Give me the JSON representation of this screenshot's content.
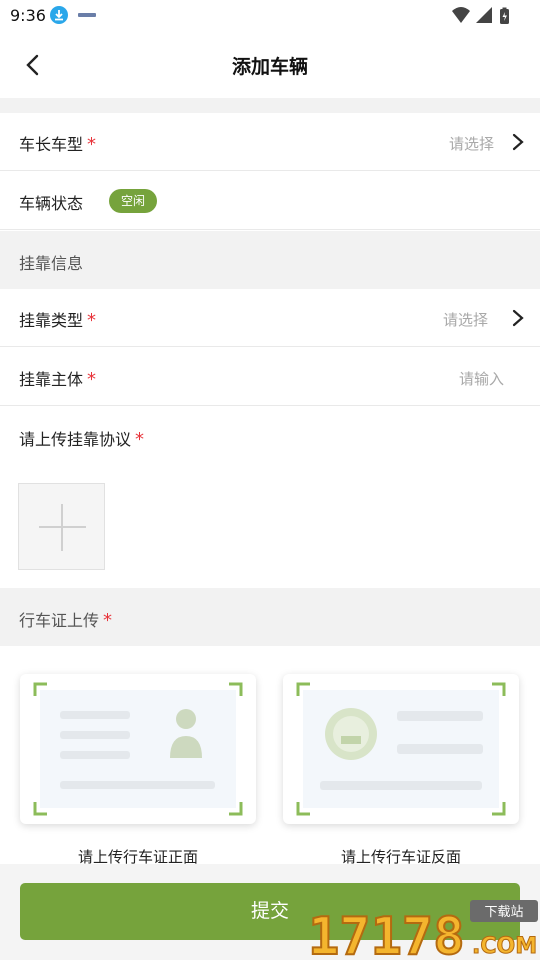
{
  "status_bar": {
    "time": "9:36",
    "icons": [
      "download-icon",
      "app-notification-icon",
      "wifi-icon",
      "signal-icon",
      "battery-icon"
    ]
  },
  "header": {
    "title": "添加车辆",
    "back_icon": "chevron-left-icon"
  },
  "form": {
    "vehicle_type": {
      "label": "车长车型",
      "required_mark": "*",
      "placeholder": "请选择"
    },
    "vehicle_status": {
      "label": "车辆状态",
      "badge": "空闲"
    },
    "affiliation_section": "挂靠信息",
    "affiliation_type": {
      "label": "挂靠类型",
      "required_mark": "*",
      "placeholder": "请选择"
    },
    "affiliation_entity": {
      "label": "挂靠主体",
      "required_mark": "*",
      "placeholder": "请输入"
    },
    "agreement_upload": {
      "label": "请上传挂靠协议",
      "required_mark": "*"
    },
    "license_section": {
      "label": "行车证上传",
      "required_mark": "*"
    },
    "license_front_caption": "请上传行车证正面",
    "license_back_caption": "请上传行车证反面"
  },
  "submit_label": "提交",
  "watermark": {
    "number": "17178",
    "domain": ".COM",
    "badge": "下载站"
  },
  "colors": {
    "accent": "#76a33c",
    "required": "#e8343b",
    "placeholder": "#a9a9a9",
    "section_bg": "#f2f2f2"
  }
}
